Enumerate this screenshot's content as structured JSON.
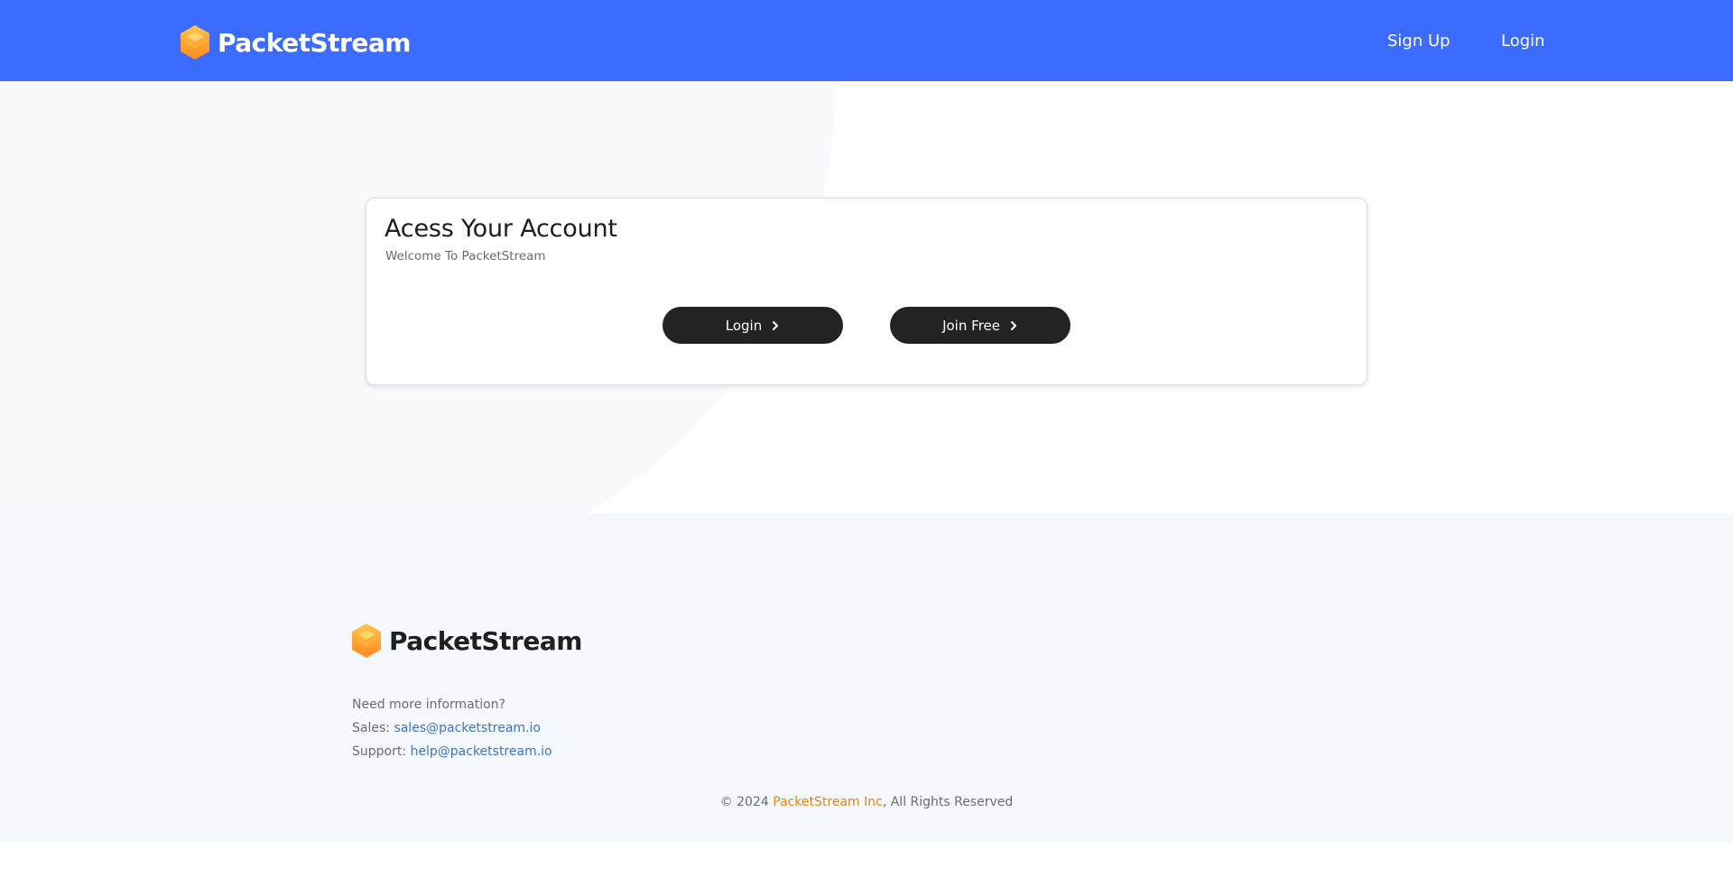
{
  "header": {
    "brand_name": "PacketStream",
    "logo_icon": "hexagon-cube-icon",
    "nav": {
      "signup_label": "Sign Up",
      "login_label": "Login"
    },
    "background_color": "#3b6bff"
  },
  "card": {
    "title": "Acess Your Account",
    "subtitle": "Welcome To PacketStream",
    "buttons": {
      "login_label": "Login",
      "join_label": "Join Free",
      "icon": "chevron-right-icon"
    }
  },
  "footer": {
    "brand_name": "PacketStream",
    "info_question": "Need more information?",
    "sales_label": "Sales:",
    "sales_email": "sales@packetstream.io",
    "support_label": "Support:",
    "support_email": "help@packetstream.io",
    "copyright_prefix": "© 2024",
    "company_name": "PacketStream Inc",
    "copyright_suffix": ", All Rights Reserved",
    "link_color": "#3d73c9",
    "company_color": "#d98718"
  }
}
